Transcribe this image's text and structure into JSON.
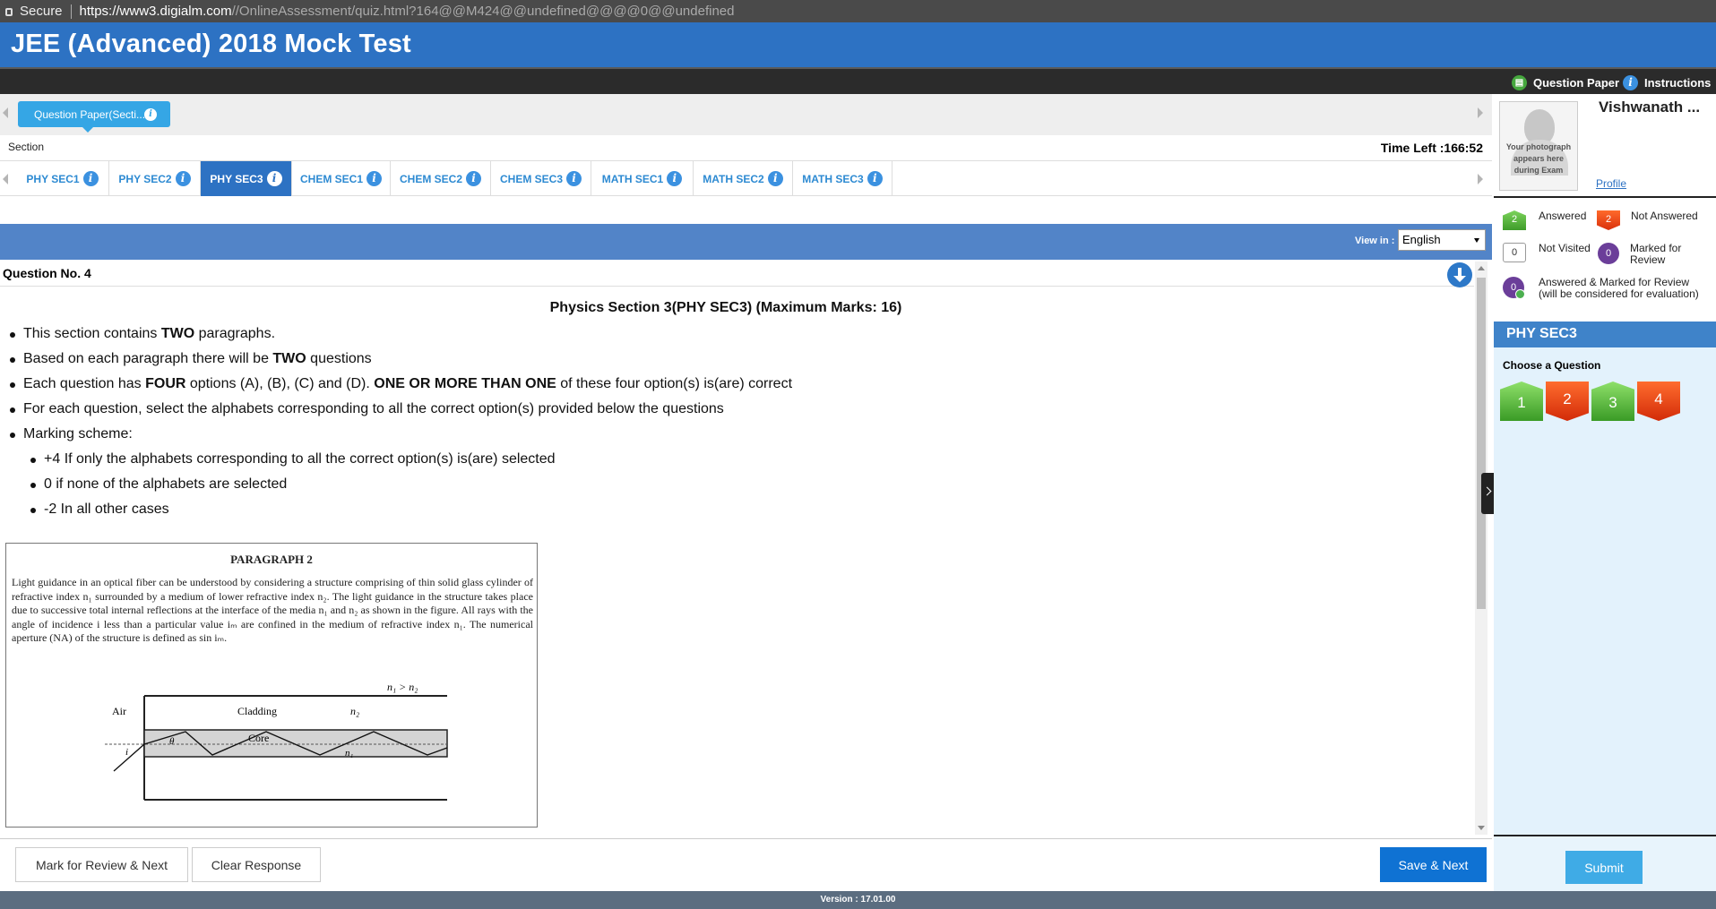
{
  "browser": {
    "secure_label": "Secure",
    "url_host": "https://www3.digialm.com",
    "url_path": "//OnlineAssessment/quiz.html?164@@M424@@undefined@@@@0@@undefined"
  },
  "app": {
    "title": "JEE (Advanced) 2018 Mock Test"
  },
  "toolbar": {
    "question_paper": "Question Paper",
    "instructions": "Instructions"
  },
  "question_paper_tab": {
    "label": "Question Paper(Secti..."
  },
  "section": {
    "label": "Section",
    "time_left": "Time Left :166:52"
  },
  "section_tabs": [
    {
      "label": "PHY SEC1",
      "active": false
    },
    {
      "label": "PHY SEC2",
      "active": false
    },
    {
      "label": "PHY SEC3",
      "active": true
    },
    {
      "label": "CHEM SEC1",
      "active": false
    },
    {
      "label": "CHEM SEC2",
      "active": false
    },
    {
      "label": "CHEM SEC3",
      "active": false
    },
    {
      "label": "MATH SEC1",
      "active": false
    },
    {
      "label": "MATH SEC2",
      "active": false
    },
    {
      "label": "MATH SEC3",
      "active": false
    }
  ],
  "language": {
    "label": "View in :",
    "selected": "English"
  },
  "question": {
    "number_label": "Question No. 4",
    "heading": "Physics Section 3(PHY SEC3) (Maximum Marks: 16)",
    "instructions": [
      {
        "pre": "This section contains ",
        "bold": "TWO",
        "post": " paragraphs."
      },
      {
        "pre": "Based on each paragraph there will be ",
        "bold": "TWO",
        "post": " questions"
      },
      {
        "pre": "Each question has ",
        "bold": "FOUR",
        "mid": " options (A), (B), (C) and (D). ",
        "bold2": "ONE OR MORE THAN ONE",
        "post": " of these four option(s) is(are) correct"
      },
      {
        "text": "For each question, select the alphabets corresponding to all the correct option(s) provided below the questions"
      },
      {
        "text": "Marking scheme:"
      }
    ],
    "marking": [
      "+4 If only the alphabets corresponding to all the correct option(s) is(are) selected",
      "0 if none of the alphabets are selected",
      "-2 In all other cases"
    ],
    "paragraph": {
      "title": "PARAGRAPH 2",
      "text": "Light guidance in an optical fiber can be understood by considering a structure comprising of thin solid glass cylinder of refractive index n₁ surrounded by a medium of lower refractive index n₂. The light guidance in the structure takes place due to successive total internal reflections at the interface of the media n₁ and n₂ as shown in the figure. All rays with the angle of incidence i less than a particular value iₘ are confined in the medium of refractive index n₁. The numerical aperture (NA) of the structure is defined as sin iₘ.",
      "figure": {
        "cond": "n₁ > n₂",
        "air": "Air",
        "cladding": "Cladding",
        "n2": "n₂",
        "core": "Core",
        "n1": "n₁",
        "theta": "θ",
        "i": "i"
      }
    }
  },
  "actions": {
    "mark_review": "Mark for Review & Next",
    "clear": "Clear Response",
    "save_next": "Save & Next",
    "submit": "Submit"
  },
  "version": "Version : 17.01.00",
  "candidate": {
    "name": "Vishwanath ...",
    "photo_text": "Your photograph appears here during Exam",
    "profile": "Profile"
  },
  "legend": {
    "answered": {
      "count": "2",
      "label": "Answered"
    },
    "not_answered": {
      "count": "2",
      "label": "Not Answered"
    },
    "not_visited": {
      "count": "0",
      "label": "Not Visited"
    },
    "marked": {
      "count": "0",
      "label": "Marked for Review"
    },
    "answered_marked": {
      "count": "0",
      "label": "Answered & Marked for Review (will be considered for evaluation)"
    }
  },
  "palette": {
    "section": "PHY SEC3",
    "choose": "Choose a Question",
    "questions": [
      {
        "n": "1",
        "status": "answered"
      },
      {
        "n": "2",
        "status": "not-answered"
      },
      {
        "n": "3",
        "status": "answered"
      },
      {
        "n": "4",
        "status": "not-answered"
      }
    ]
  },
  "colors": {
    "header_blue": "#2d72c3",
    "answered_green": "#4caf50",
    "not_answered_red": "#e0400f",
    "marked_purple": "#6b3e99"
  }
}
